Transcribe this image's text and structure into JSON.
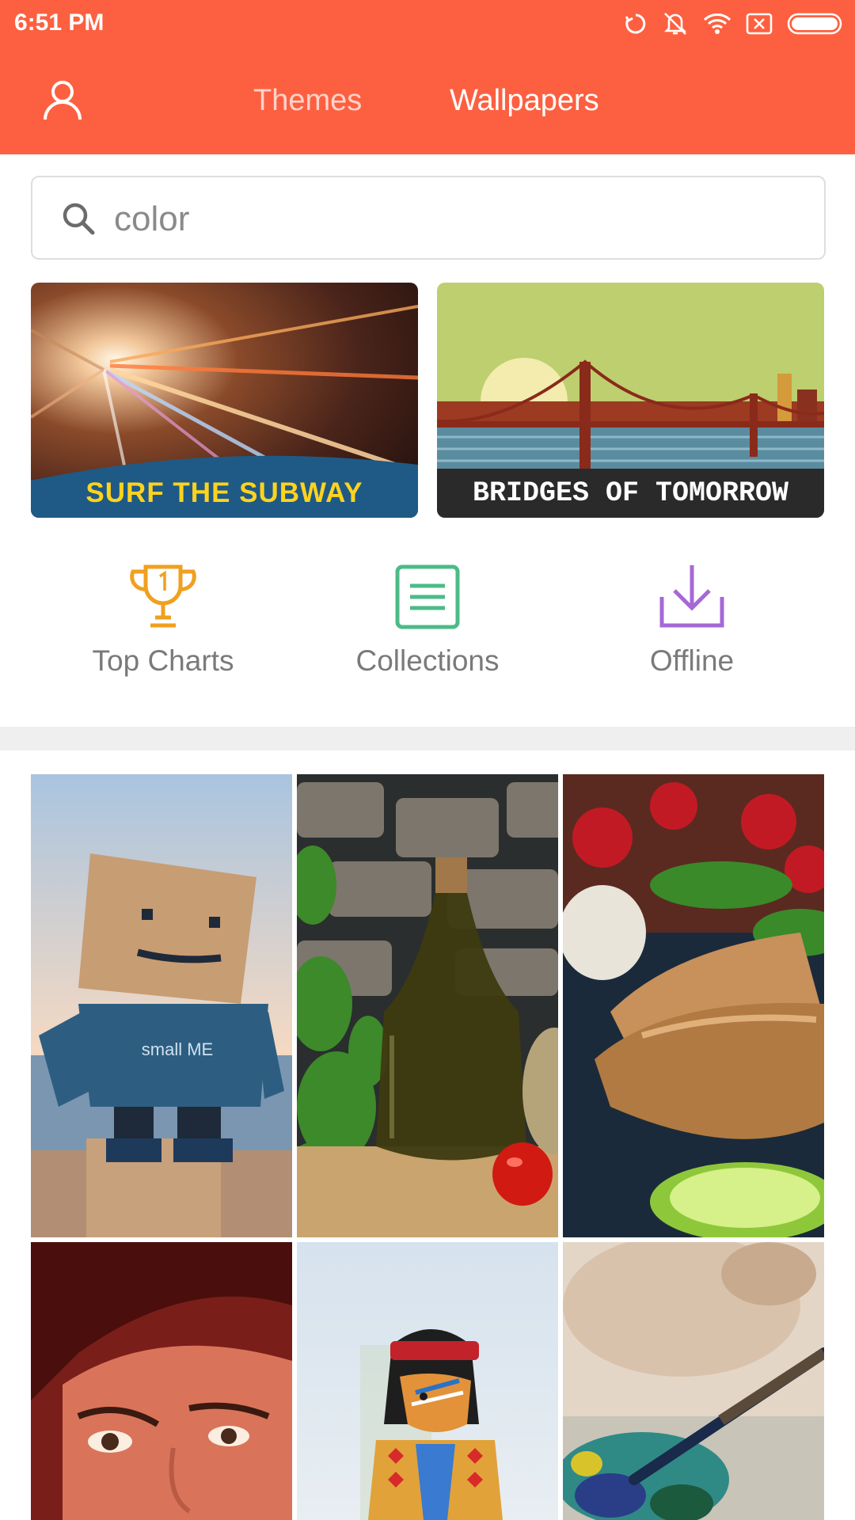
{
  "status_bar": {
    "time": "6:51 PM",
    "icons": [
      "sync-icon",
      "vibrate-icon",
      "wifi-icon",
      "sim-none-icon",
      "battery-icon"
    ]
  },
  "header": {
    "profile_icon": "person-icon",
    "tabs": [
      {
        "label": "Themes",
        "active": false
      },
      {
        "label": "Wallpapers",
        "active": true
      }
    ],
    "background_color": "#fd6040"
  },
  "search": {
    "value": "color",
    "icon": "search-icon"
  },
  "banners": [
    {
      "caption": "SURF THE SUBWAY",
      "caption_color": "#ffd21f"
    },
    {
      "caption": "BRIDGES OF TOMORROW",
      "caption_color": "#ffffff"
    }
  ],
  "shortcuts": [
    {
      "label": "Top Charts",
      "icon": "trophy-icon",
      "color": "#f0a020"
    },
    {
      "label": "Collections",
      "icon": "list-icon",
      "color": "#4cbb88"
    },
    {
      "label": "Offline",
      "icon": "download-icon",
      "color": "#a668d6"
    }
  ],
  "wallpapers": [
    {
      "subject": "cardboard-robot",
      "print_text": "small ME"
    },
    {
      "subject": "olive-oil-bottle"
    },
    {
      "subject": "samosas"
    },
    {
      "subject": "painted-face"
    },
    {
      "subject": "toy-figure"
    },
    {
      "subject": "paint-palette"
    }
  ]
}
